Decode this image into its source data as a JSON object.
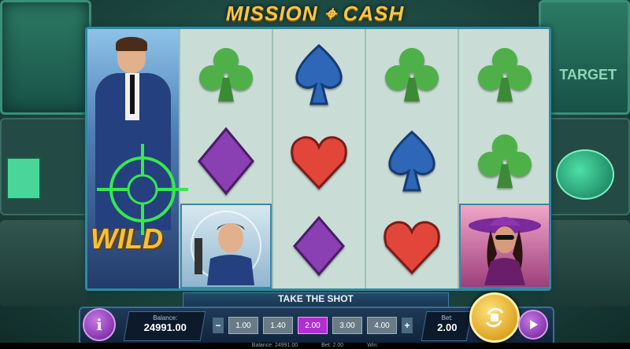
{
  "game": {
    "title": "MISSION ⌖ CASH"
  },
  "background": {
    "target_sign": "TARGET"
  },
  "reels": [
    {
      "id": 1,
      "symbols": [
        "wild-agent",
        "wild-agent",
        "wild-agent"
      ],
      "wild_label": "WILD"
    },
    {
      "id": 2,
      "symbols": [
        "club",
        "diamond",
        "agent"
      ]
    },
    {
      "id": 3,
      "symbols": [
        "spade",
        "heart",
        "diamond"
      ]
    },
    {
      "id": 4,
      "symbols": [
        "club",
        "spade",
        "heart"
      ]
    },
    {
      "id": 5,
      "symbols": [
        "club",
        "club",
        "lady"
      ]
    }
  ],
  "colors": {
    "club": "#4fb04a",
    "spade": "#2e66b8",
    "diamond": "#8a3fb3",
    "heart": "#e2453a",
    "accent": "#f2c23d"
  },
  "bottom": {
    "banner": "TAKE THE SHOT",
    "balance_label": "Balance:",
    "balance_value": "24991.00",
    "bet_label": "Bet:",
    "bet_value": "2.00",
    "bet_options": [
      "1.00",
      "1.40",
      "2.00",
      "3.00",
      "4.00"
    ],
    "selected_bet": "2.00",
    "minus": "−",
    "plus": "+",
    "info": "i"
  },
  "status": {
    "balance": "Balance: 24991.00",
    "bet": "Bet: 2.00",
    "win": "Win:"
  }
}
